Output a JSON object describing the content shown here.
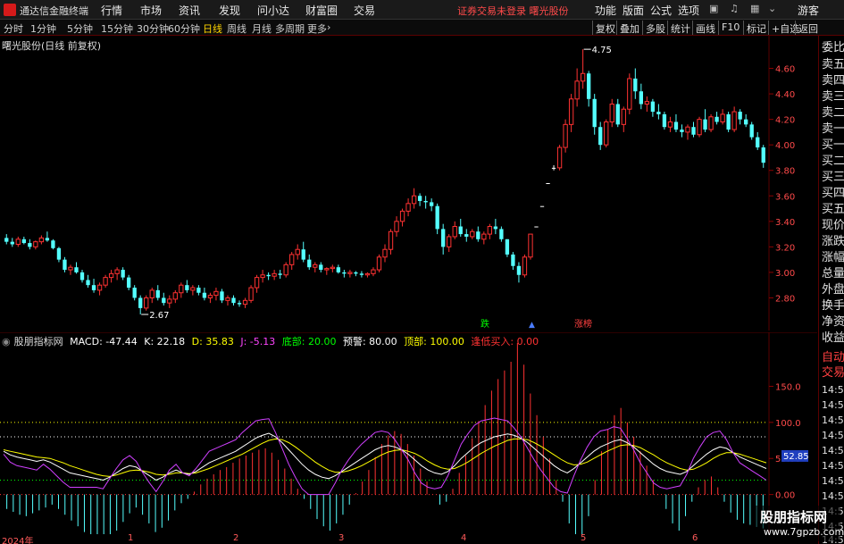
{
  "app": {
    "title": "通达信金融终端",
    "menus": [
      "行情",
      "市场",
      "资讯",
      "发现",
      "问小达",
      "财富圈",
      "交易"
    ],
    "status": "证券交易未登录  曙光股份",
    "right_menus": [
      "功能",
      "版面",
      "公式",
      "选项"
    ],
    "guest": "游客"
  },
  "toolbar": {
    "periods": [
      "分时",
      "1分钟",
      "5分钟",
      "15分钟",
      "30分钟",
      "60分钟",
      "日线",
      "周线",
      "月线",
      "多周期",
      "更多"
    ],
    "active_period": "日线",
    "buttons": [
      "复权",
      "叠加",
      "多股",
      "统计",
      "画线",
      "F10",
      "标记",
      "+自选",
      "返回"
    ]
  },
  "main_chart": {
    "title": "曙光股份(日线 前复权)",
    "price_labels": [
      "4.60",
      "4.40",
      "4.20",
      "4.00",
      "3.80",
      "3.60",
      "3.40",
      "3.20",
      "3.00",
      "2.80"
    ],
    "high_marker": "4.75",
    "low_marker": "2.67",
    "signal_labels": [
      "跌",
      "涨榜"
    ],
    "colors": {
      "up": "#ff3232",
      "down": "#54ffff",
      "flat": "#ffffff"
    }
  },
  "indicator": {
    "name": "股朋指标网",
    "items": [
      {
        "text": "MACD: -47.44",
        "color": "#ffffff"
      },
      {
        "text": "K: 22.18",
        "color": "#ffffff"
      },
      {
        "text": "D: 35.83",
        "color": "#ffff00"
      },
      {
        "text": "J: -5.13",
        "color": "#ff44ff"
      },
      {
        "text": "底部: 20.00",
        "color": "#00ff00"
      },
      {
        "text": "预警: 80.00",
        "color": "#ffffff"
      },
      {
        "text": "顶部: 100.00",
        "color": "#ffff00"
      },
      {
        "text": "逢低买入: 0.00",
        "color": "#ff3232"
      }
    ],
    "scale_labels": [
      "150.0",
      "100.0",
      "50.00",
      "0.00"
    ],
    "current_value": "52.85"
  },
  "sidebar": {
    "items": [
      "委比",
      "卖五",
      "卖四",
      "卖三",
      "卖二",
      "卖一",
      "买一",
      "买二",
      "买三",
      "买四",
      "买五",
      "现价",
      "涨跌",
      "涨幅",
      "总量",
      "外盘",
      "换手",
      "净资",
      "收益"
    ],
    "trade": [
      "自动",
      "交易"
    ],
    "times": [
      "14:56",
      "14:56",
      "14:56",
      "14:56",
      "14:56",
      "14:56",
      "14:56",
      "14:56",
      "14:56",
      "14:56",
      "14:56"
    ]
  },
  "date_axis": {
    "labels": [
      "2024年",
      "1",
      "2",
      "3",
      "4",
      "5",
      "6"
    ]
  },
  "watermark": {
    "title": "股朋指标网",
    "url": "www.7gpzb.com"
  },
  "chart_data": {
    "type": "candlestick",
    "price_axis": {
      "min": 2.6,
      "max": 4.8
    },
    "candles": [
      [
        3.27,
        3.3,
        3.22,
        3.24
      ],
      [
        3.24,
        3.27,
        3.2,
        3.22
      ],
      [
        3.22,
        3.28,
        3.2,
        3.26
      ],
      [
        3.26,
        3.28,
        3.22,
        3.23
      ],
      [
        3.23,
        3.26,
        3.18,
        3.2
      ],
      [
        3.2,
        3.25,
        3.18,
        3.24
      ],
      [
        3.24,
        3.29,
        3.22,
        3.27
      ],
      [
        3.27,
        3.32,
        3.24,
        3.25
      ],
      [
        3.25,
        3.26,
        3.18,
        3.19
      ],
      [
        3.19,
        3.2,
        3.08,
        3.1
      ],
      [
        3.1,
        3.12,
        3.0,
        3.02
      ],
      [
        3.02,
        3.06,
        2.98,
        3.04
      ],
      [
        3.04,
        3.08,
        2.99,
        3.0
      ],
      [
        3.0,
        3.02,
        2.92,
        2.94
      ],
      [
        2.94,
        2.98,
        2.88,
        2.9
      ],
      [
        2.9,
        2.95,
        2.84,
        2.86
      ],
      [
        2.86,
        2.92,
        2.82,
        2.9
      ],
      [
        2.9,
        2.98,
        2.88,
        2.96
      ],
      [
        2.96,
        3.02,
        2.92,
        2.99
      ],
      [
        2.99,
        3.04,
        2.94,
        3.02
      ],
      [
        3.02,
        3.04,
        2.94,
        2.96
      ],
      [
        2.96,
        2.98,
        2.86,
        2.88
      ],
      [
        2.88,
        2.9,
        2.78,
        2.8
      ],
      [
        2.8,
        2.82,
        2.67,
        2.72
      ],
      [
        2.72,
        2.82,
        2.7,
        2.8
      ],
      [
        2.8,
        2.88,
        2.76,
        2.86
      ],
      [
        2.86,
        2.9,
        2.78,
        2.8
      ],
      [
        2.8,
        2.84,
        2.74,
        2.76
      ],
      [
        2.76,
        2.82,
        2.72,
        2.79
      ],
      [
        2.79,
        2.86,
        2.76,
        2.84
      ],
      [
        2.84,
        2.92,
        2.8,
        2.9
      ],
      [
        2.9,
        2.94,
        2.84,
        2.86
      ],
      [
        2.86,
        2.9,
        2.82,
        2.88
      ],
      [
        2.88,
        2.9,
        2.82,
        2.84
      ],
      [
        2.84,
        2.88,
        2.78,
        2.8
      ],
      [
        2.8,
        2.84,
        2.76,
        2.82
      ],
      [
        2.82,
        2.88,
        2.78,
        2.85
      ],
      [
        2.85,
        2.87,
        2.76,
        2.78
      ],
      [
        2.78,
        2.82,
        2.74,
        2.8
      ],
      [
        2.8,
        2.82,
        2.74,
        2.76
      ],
      [
        2.76,
        2.78,
        2.73,
        2.75
      ],
      [
        2.75,
        2.8,
        2.72,
        2.78
      ],
      [
        2.78,
        2.9,
        2.76,
        2.88
      ],
      [
        2.88,
        2.98,
        2.84,
        2.96
      ],
      [
        2.96,
        3.02,
        2.92,
        2.98
      ],
      [
        2.98,
        3.0,
        2.94,
        2.97
      ],
      [
        2.97,
        3.02,
        2.94,
        2.99
      ],
      [
        2.99,
        3.02,
        2.95,
        2.98
      ],
      [
        2.98,
        3.08,
        2.96,
        3.06
      ],
      [
        3.06,
        3.16,
        3.02,
        3.14
      ],
      [
        3.14,
        3.22,
        3.1,
        3.18
      ],
      [
        3.18,
        3.24,
        3.08,
        3.1
      ],
      [
        3.1,
        3.14,
        3.02,
        3.04
      ],
      [
        3.04,
        3.08,
        3.0,
        3.06
      ],
      [
        3.06,
        3.08,
        3.0,
        3.02
      ],
      [
        3.02,
        3.04,
        2.98,
        3.03
      ],
      [
        3.03,
        3.06,
        3.0,
        3.04
      ],
      [
        3.04,
        3.06,
        2.99,
        3.0
      ],
      [
        3.0,
        3.02,
        2.96,
        2.99
      ],
      [
        2.99,
        3.02,
        2.96,
        3.0
      ],
      [
        3.0,
        3.01,
        2.97,
        2.99
      ],
      [
        2.99,
        3.01,
        2.96,
        2.98
      ],
      [
        2.98,
        3.0,
        2.96,
        2.99
      ],
      [
        2.99,
        3.04,
        2.97,
        3.02
      ],
      [
        3.02,
        3.14,
        3.0,
        3.12
      ],
      [
        3.12,
        3.22,
        3.08,
        3.18
      ],
      [
        3.18,
        3.34,
        3.14,
        3.32
      ],
      [
        3.32,
        3.44,
        3.28,
        3.4
      ],
      [
        3.4,
        3.5,
        3.36,
        3.48
      ],
      [
        3.48,
        3.58,
        3.44,
        3.54
      ],
      [
        3.54,
        3.66,
        3.5,
        3.6
      ],
      [
        3.6,
        3.62,
        3.52,
        3.56
      ],
      [
        3.56,
        3.6,
        3.5,
        3.55
      ],
      [
        3.55,
        3.58,
        3.48,
        3.52
      ],
      [
        3.52,
        3.54,
        3.3,
        3.34
      ],
      [
        3.34,
        3.38,
        3.14,
        3.2
      ],
      [
        3.2,
        3.3,
        3.16,
        3.28
      ],
      [
        3.28,
        3.4,
        3.26,
        3.36
      ],
      [
        3.36,
        3.42,
        3.28,
        3.3
      ],
      [
        3.3,
        3.34,
        3.24,
        3.28
      ],
      [
        3.28,
        3.34,
        3.26,
        3.32
      ],
      [
        3.32,
        3.36,
        3.24,
        3.26
      ],
      [
        3.26,
        3.32,
        3.22,
        3.3
      ],
      [
        3.3,
        3.38,
        3.26,
        3.36
      ],
      [
        3.36,
        3.42,
        3.3,
        3.34
      ],
      [
        3.34,
        3.36,
        3.24,
        3.26
      ],
      [
        3.26,
        3.26,
        3.12,
        3.14
      ],
      [
        3.14,
        3.16,
        3.02,
        3.05
      ],
      [
        3.05,
        3.08,
        2.92,
        2.98
      ],
      [
        2.98,
        3.14,
        2.96,
        3.12
      ],
      [
        3.12,
        3.3,
        3.1,
        3.3
      ],
      [
        3.36,
        3.36,
        3.36,
        3.36
      ],
      [
        3.52,
        3.52,
        3.52,
        3.52
      ],
      [
        3.7,
        3.7,
        3.7,
        3.7
      ],
      [
        3.82,
        3.84,
        3.8,
        3.82
      ],
      [
        3.82,
        4.0,
        3.8,
        3.98
      ],
      [
        3.98,
        4.2,
        3.94,
        4.16
      ],
      [
        4.16,
        4.4,
        4.1,
        4.36
      ],
      [
        4.36,
        4.6,
        4.3,
        4.5
      ],
      [
        4.5,
        4.75,
        4.44,
        4.56
      ],
      [
        4.56,
        4.58,
        4.3,
        4.36
      ],
      [
        4.36,
        4.4,
        4.08,
        4.14
      ],
      [
        4.14,
        4.18,
        3.96,
        4.0
      ],
      [
        4.0,
        4.2,
        3.98,
        4.18
      ],
      [
        4.18,
        4.36,
        4.14,
        4.32
      ],
      [
        4.32,
        4.36,
        4.14,
        4.16
      ],
      [
        4.16,
        4.3,
        4.1,
        4.28
      ],
      [
        4.28,
        4.56,
        4.24,
        4.52
      ],
      [
        4.52,
        4.6,
        4.36,
        4.42
      ],
      [
        4.42,
        4.48,
        4.28,
        4.32
      ],
      [
        4.32,
        4.38,
        4.26,
        4.34
      ],
      [
        4.34,
        4.36,
        4.22,
        4.26
      ],
      [
        4.26,
        4.32,
        4.2,
        4.24
      ],
      [
        4.24,
        4.26,
        4.12,
        4.14
      ],
      [
        4.14,
        4.22,
        4.1,
        4.18
      ],
      [
        4.18,
        4.24,
        4.1,
        4.12
      ],
      [
        4.12,
        4.16,
        4.06,
        4.1
      ],
      [
        4.1,
        4.16,
        4.04,
        4.14
      ],
      [
        4.14,
        4.18,
        4.06,
        4.08
      ],
      [
        4.08,
        4.22,
        4.06,
        4.2
      ],
      [
        4.2,
        4.28,
        4.1,
        4.12
      ],
      [
        4.12,
        4.24,
        4.1,
        4.22
      ],
      [
        4.22,
        4.26,
        4.16,
        4.18
      ],
      [
        4.18,
        4.28,
        4.16,
        4.24
      ],
      [
        4.24,
        4.26,
        4.1,
        4.12
      ],
      [
        4.12,
        4.3,
        4.1,
        4.26
      ],
      [
        4.26,
        4.28,
        4.16,
        4.2
      ],
      [
        4.2,
        4.24,
        4.14,
        4.16
      ],
      [
        4.16,
        4.18,
        4.04,
        4.06
      ],
      [
        4.06,
        4.1,
        3.96,
        3.98
      ],
      [
        3.98,
        4.0,
        3.82,
        3.86
      ]
    ],
    "kdj": {
      "k": [
        60,
        55,
        52,
        50,
        48,
        46,
        48,
        45,
        40,
        35,
        30,
        28,
        26,
        24,
        22,
        20,
        24,
        30,
        36,
        40,
        38,
        32,
        26,
        20,
        24,
        30,
        34,
        30,
        28,
        32,
        38,
        44,
        48,
        52,
        56,
        60,
        66,
        72,
        78,
        82,
        85,
        80,
        72,
        62,
        52,
        42,
        34,
        28,
        24,
        22,
        26,
        32,
        38,
        44,
        50,
        56,
        62,
        66,
        68,
        66,
        62,
        56,
        48,
        40,
        34,
        30,
        28,
        32,
        40,
        50,
        58,
        66,
        72,
        76,
        80,
        82,
        84,
        82,
        78,
        72,
        64,
        56,
        48,
        40,
        34,
        30,
        36,
        44,
        52,
        60,
        66,
        70,
        74,
        76,
        72,
        66,
        58,
        50,
        42,
        36,
        32,
        30,
        28,
        32,
        40,
        48,
        56,
        62,
        66,
        64,
        58,
        52,
        48,
        44,
        40,
        36
      ],
      "d": [
        62,
        60,
        58,
        56,
        54,
        52,
        51,
        50,
        47,
        44,
        40,
        37,
        34,
        31,
        28,
        26,
        25,
        27,
        30,
        33,
        34,
        33,
        31,
        28,
        27,
        28,
        30,
        30,
        29,
        30,
        33,
        36,
        40,
        44,
        48,
        52,
        56,
        61,
        66,
        71,
        75,
        77,
        76,
        72,
        66,
        59,
        52,
        45,
        39,
        34,
        31,
        31,
        33,
        36,
        40,
        45,
        50,
        55,
        59,
        61,
        62,
        60,
        57,
        52,
        46,
        41,
        37,
        35,
        36,
        40,
        45,
        51,
        57,
        62,
        67,
        71,
        75,
        77,
        77,
        76,
        72,
        67,
        61,
        55,
        49,
        44,
        41,
        42,
        45,
        50,
        55,
        60,
        64,
        68,
        69,
        68,
        65,
        60,
        55,
        49,
        44,
        40,
        36,
        34,
        35,
        39,
        44,
        50,
        55,
        58,
        58,
        56,
        53,
        50,
        47,
        44
      ],
      "j": [
        56,
        45,
        40,
        38,
        36,
        34,
        42,
        35,
        26,
        17,
        10,
        10,
        10,
        10,
        10,
        8,
        22,
        36,
        48,
        54,
        46,
        30,
        16,
        4,
        18,
        34,
        42,
        30,
        26,
        36,
        48,
        60,
        64,
        68,
        72,
        76,
        86,
        94,
        102,
        104,
        105,
        86,
        64,
        42,
        24,
        8,
        0,
        0,
        0,
        0,
        16,
        34,
        48,
        60,
        70,
        78,
        86,
        88,
        86,
        76,
        62,
        48,
        30,
        16,
        10,
        8,
        10,
        26,
        48,
        70,
        84,
        96,
        102,
        104,
        106,
        104,
        102,
        92,
        80,
        64,
        48,
        34,
        22,
        10,
        4,
        2,
        26,
        48,
        66,
        80,
        88,
        90,
        94,
        92,
        78,
        62,
        44,
        30,
        16,
        10,
        8,
        10,
        12,
        28,
        50,
        66,
        80,
        86,
        88,
        76,
        58,
        44,
        38,
        32,
        26,
        20
      ]
    },
    "macd": [
      -20,
      -24,
      -28,
      -30,
      -26,
      -22,
      -18,
      -14,
      -20,
      -28,
      -36,
      -44,
      -52,
      -58,
      -62,
      -66,
      -60,
      -50,
      -38,
      -26,
      -18,
      -28,
      -40,
      -52,
      -46,
      -36,
      -22,
      -12,
      -6,
      4,
      14,
      22,
      28,
      34,
      38,
      44,
      50,
      54,
      58,
      62,
      64,
      58,
      48,
      36,
      22,
      8,
      -6,
      -20,
      -34,
      -44,
      -50,
      -40,
      -28,
      -14,
      2,
      18,
      34,
      52,
      70,
      82,
      88,
      84,
      70,
      54,
      36,
      18,
      0,
      -14,
      -10,
      8,
      30,
      54,
      78,
      102,
      124,
      144,
      160,
      172,
      184,
      210,
      180,
      140,
      110,
      80,
      50,
      20,
      -10,
      -40,
      -60,
      -70,
      -30,
      20,
      60,
      90,
      110,
      120,
      100,
      80,
      60,
      40,
      20,
      0,
      -20,
      -40,
      -50,
      -30,
      -10,
      10,
      20,
      25,
      10,
      -10,
      -25,
      -35,
      -40,
      -42,
      -45,
      -47
    ]
  }
}
